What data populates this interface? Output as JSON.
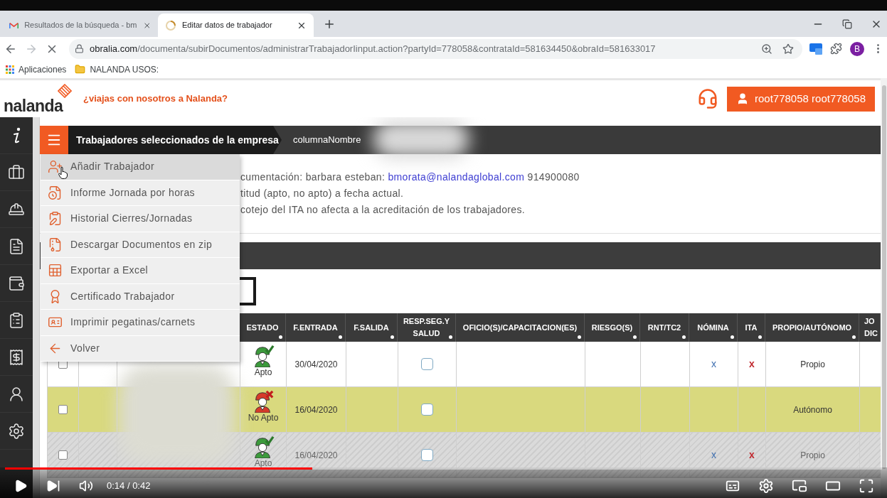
{
  "browser": {
    "tabs": [
      {
        "title": "Resultados de la búsqueda - bm",
        "selected": false
      },
      {
        "title": "Editar datos de trabajador",
        "selected": true
      }
    ],
    "url": {
      "host": "obralia.com",
      "path": "/documenta/subirDocumentos/administrarTrabajadorIinput.action?partyId=778058&contrataId=581634450&obraId=581633017"
    },
    "profile_initial": "B",
    "bookmarks": [
      "Aplicaciones",
      "NALANDA USOS:"
    ]
  },
  "header": {
    "logo": "nalanda",
    "tagline": "¿viajas con nosotros a Nalanda?",
    "user_button": "root778058 root778058"
  },
  "title_bar": {
    "title": "Trabajadores seleccionados de la empresa",
    "breadcrumb": "columnaNombre"
  },
  "menu": [
    {
      "label": "Añadir Trabajador",
      "hovered": true
    },
    {
      "label": "Informe Jornada por horas",
      "hovered": false
    },
    {
      "label": "Historial Cierres/Jornadas",
      "hovered": false
    },
    {
      "label": "Descargar Documentos en zip",
      "hovered": false
    },
    {
      "label": "Exportar a Excel",
      "hovered": false
    },
    {
      "label": "Certificado Trabajador",
      "hovered": false
    },
    {
      "label": "Imprimir pegatinas/carnets",
      "hovered": false
    },
    {
      "label": "Volver",
      "hovered": false
    }
  ],
  "info_lines": [
    {
      "text": "cumentación: barbara esteban:",
      "link": "bmorata@nalandaglobal.com",
      "phone": "914900080"
    },
    {
      "text": "titud (apto, no apto) a fecha actual."
    },
    {
      "text": "cotejo del ITA no afecta a la acreditación de los trabajadores."
    }
  ],
  "table": {
    "columns": [
      "ESTADO",
      "F.ENTRADA",
      "F.SALIDA",
      "RESP.SEG.Y SALUD",
      "OFICIO(S)/CAPACITACION(ES)",
      "RIESGO(S)",
      "RNT/TC2",
      "NÓMINA",
      "ITA",
      "PROPIO/AUTÓNOMO",
      "JO DIC"
    ],
    "rows": [
      {
        "kind": "normal",
        "checked": false,
        "apto": true,
        "estado": "Apto",
        "f_entrada": "30/04/2020",
        "resp_checked": false,
        "nomina": "x",
        "ita": "x",
        "propio_autonomo": "Propio"
      },
      {
        "kind": "warning",
        "checked": false,
        "apto": false,
        "estado": "No Apto",
        "f_entrada": "16/04/2020",
        "resp_checked": false,
        "propio_autonomo": "Autónomo"
      },
      {
        "kind": "inactive",
        "checked": false,
        "apto": true,
        "estado": "Apto",
        "f_entrada": "16/04/2020",
        "resp_checked": false,
        "nomina": "x",
        "ita": "x",
        "propio_autonomo": "Propio"
      }
    ]
  },
  "player": {
    "level": 0.35,
    "time": "0:14 / 0:42"
  }
}
